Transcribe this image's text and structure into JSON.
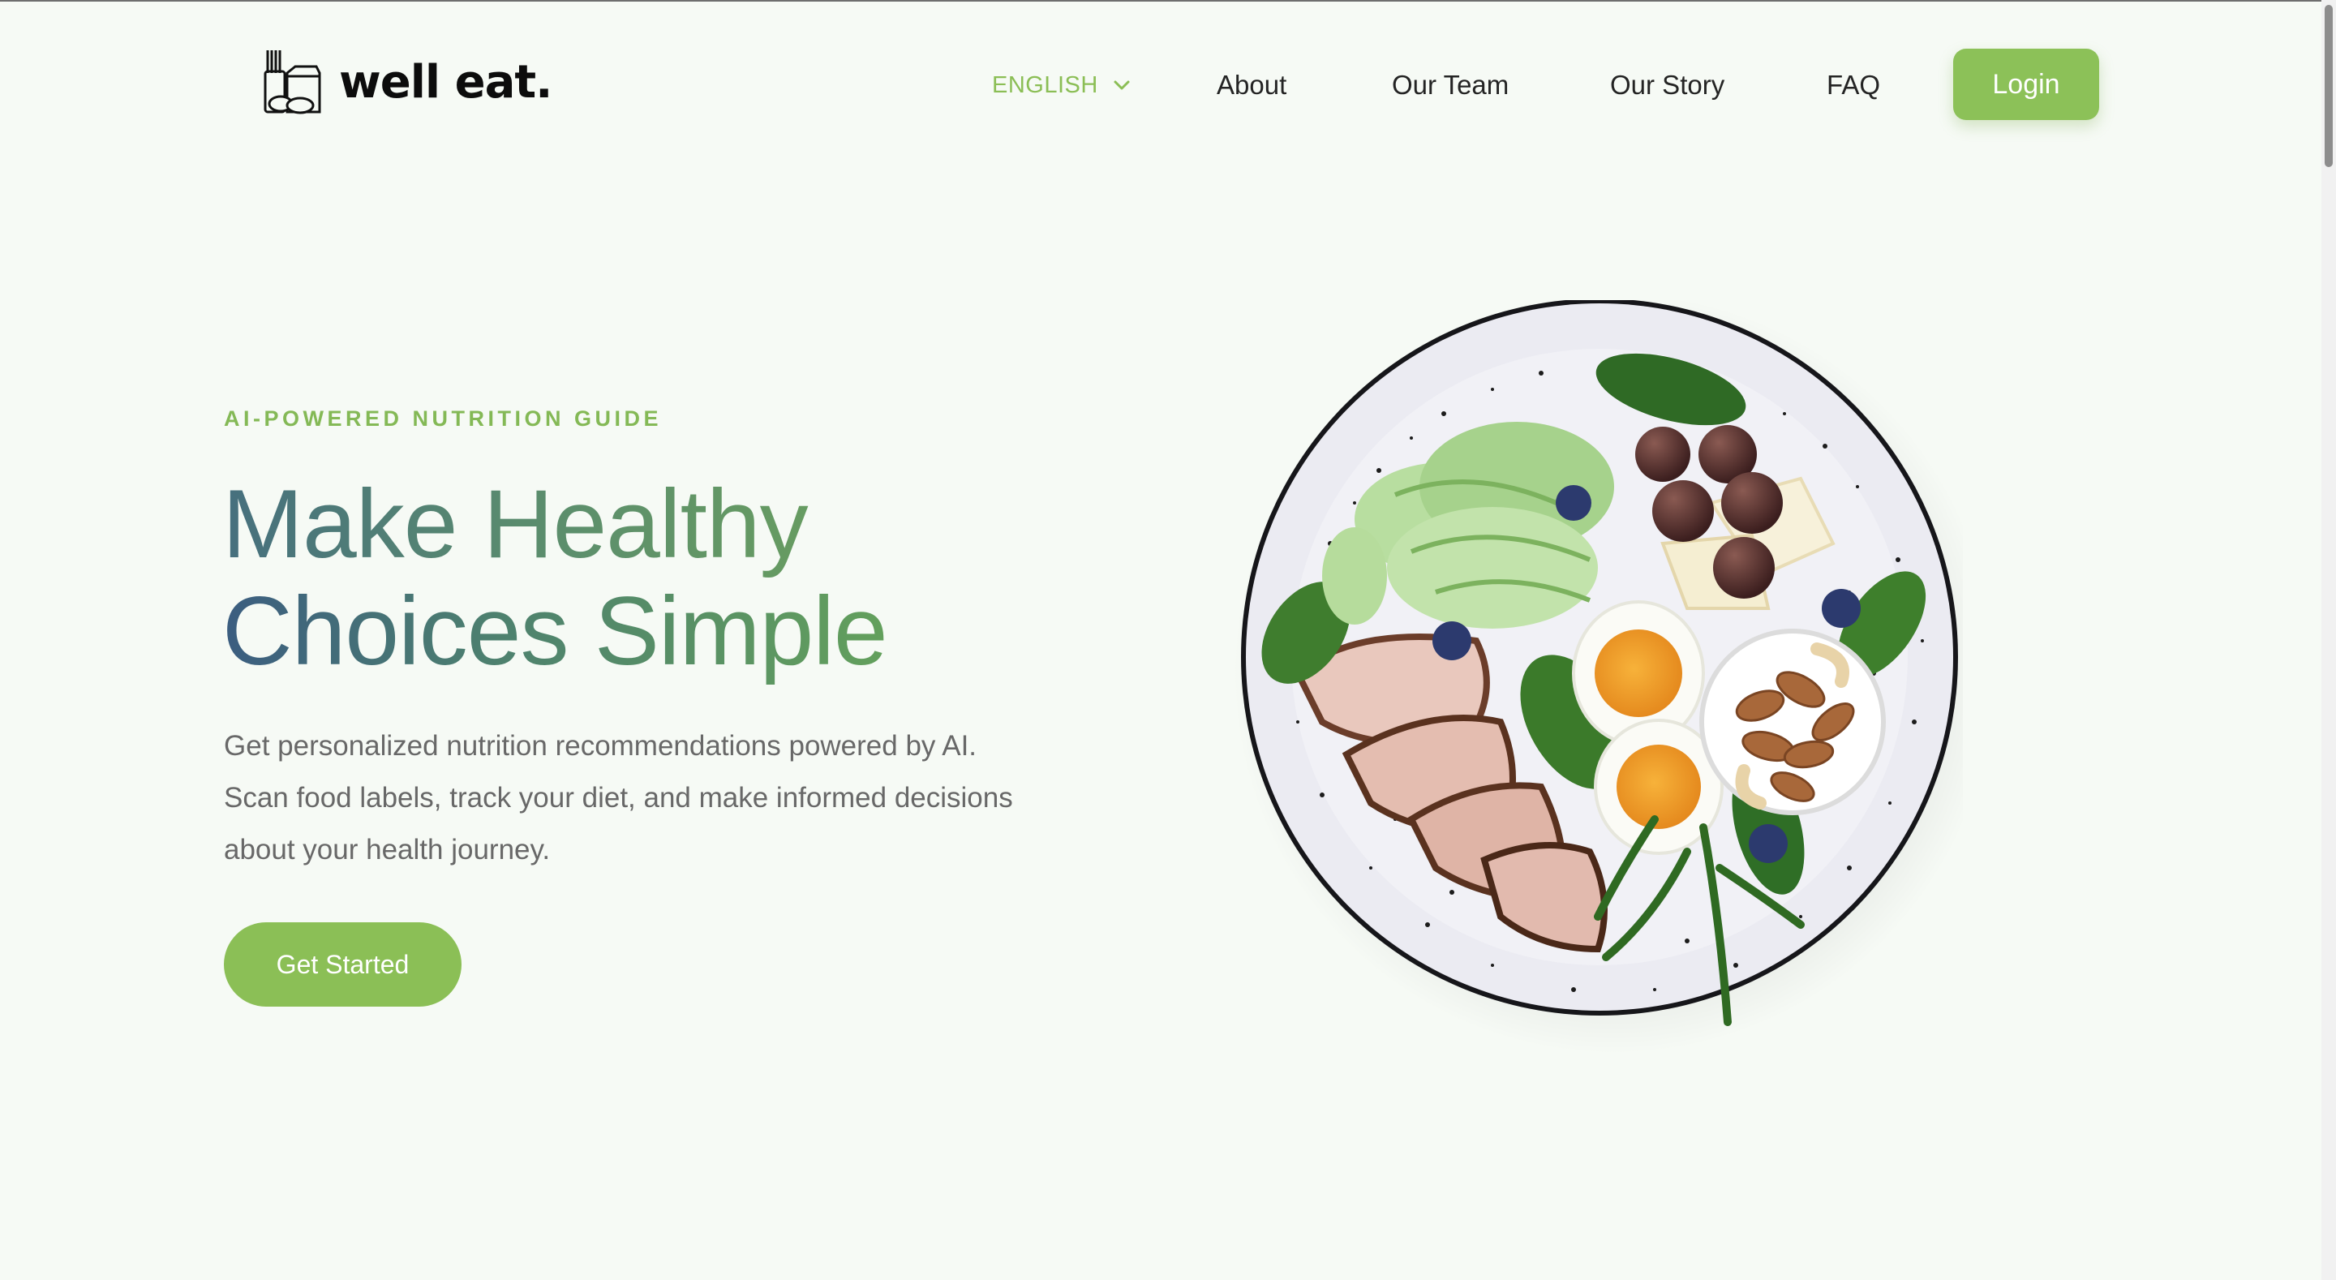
{
  "brand": {
    "name": "well eat.",
    "logo_icon": "groceries-bag-icon"
  },
  "nav": {
    "language": {
      "label": "ENGLISH",
      "icon": "chevron-down-icon"
    },
    "links": [
      {
        "label": "About"
      },
      {
        "label": "Our Team"
      },
      {
        "label": "Our Story"
      },
      {
        "label": "FAQ"
      }
    ],
    "login_label": "Login"
  },
  "hero": {
    "eyebrow": "AI-POWERED NUTRITION GUIDE",
    "headline_line1": "Make Healthy",
    "headline_line2": "Choices Simple",
    "description": "Get personalized nutrition recommendations powered by AI. Scan food labels, track your diet, and make informed decisions about your health journey.",
    "cta_label": "Get Started",
    "image": "healthy-food-plate-illustration"
  },
  "colors": {
    "accent_green": "#8bbf56",
    "headline_blue": "#3b5d80",
    "headline_green": "#63a05c",
    "page_background": "#f6faf5",
    "body_text": "#686868"
  }
}
